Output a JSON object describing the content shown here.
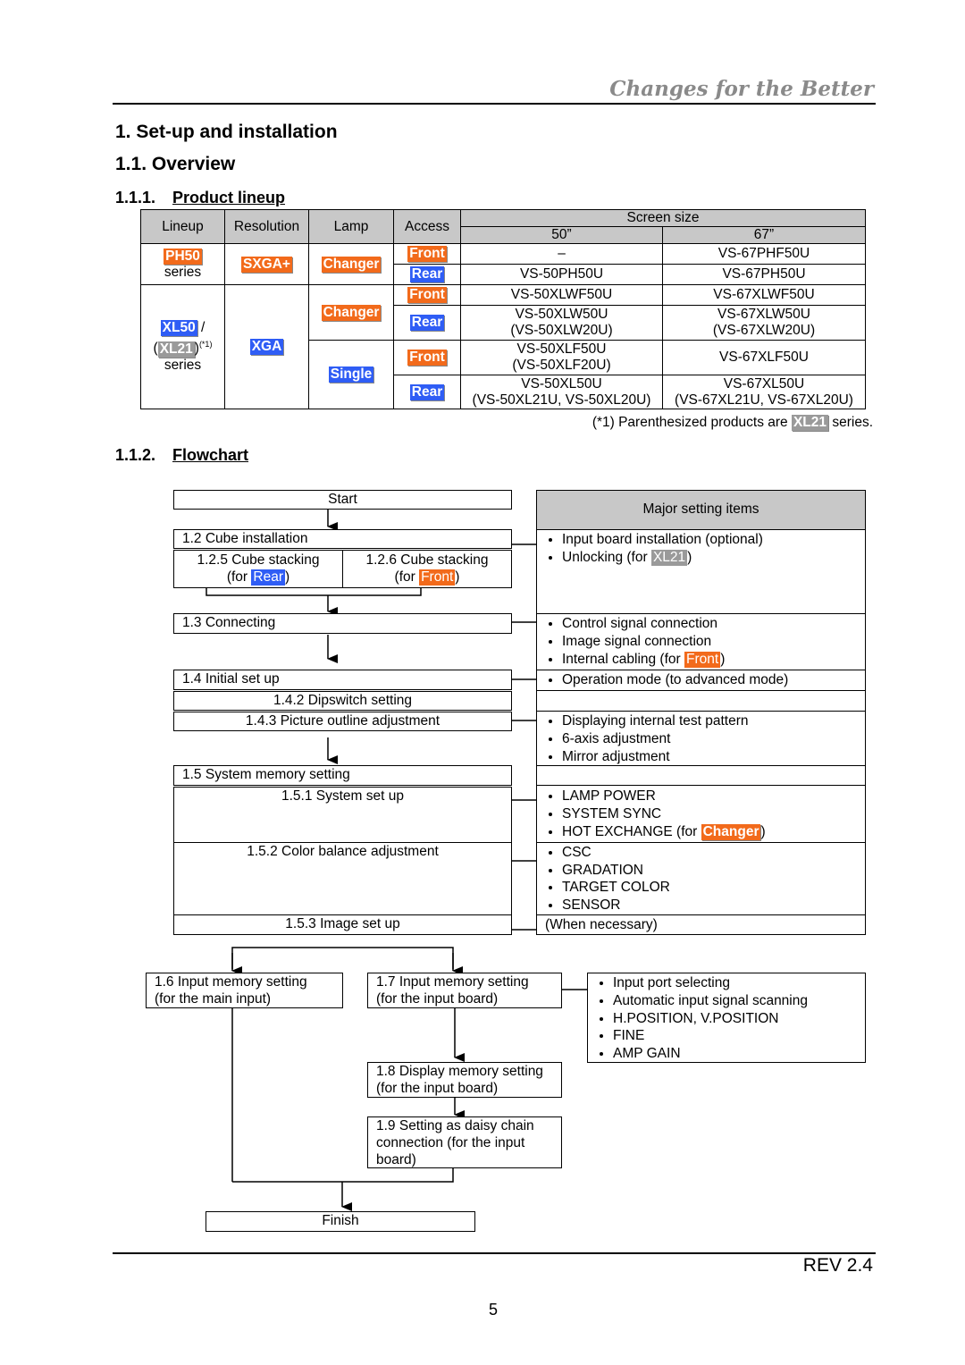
{
  "header": {
    "brand": "Changes for the Better"
  },
  "headings": {
    "h1": "1.   Set-up and installation",
    "h2": "1.1.   Overview",
    "h3a_num": "1.1.1.",
    "h3a": "Product lineup",
    "h3b_num": "1.1.2.",
    "h3b": "Flowchart"
  },
  "table": {
    "headers": {
      "lineup": "Lineup",
      "resolution": "Resolution",
      "lamp": "Lamp",
      "access": "Access",
      "screen": "Screen size",
      "s50": "50”",
      "s67": "67”"
    },
    "ph50": {
      "tag": "PH50",
      "series": "series",
      "res": "SXGA+",
      "lamp": "Changer",
      "rows": [
        {
          "access": "Front",
          "v50": "–",
          "v67": "VS-67PHF50U"
        },
        {
          "access": "Rear",
          "v50": "VS-50PH50U",
          "v67": "VS-67PH50U"
        }
      ]
    },
    "xl": {
      "tag1": "XL50",
      "sep": "/",
      "tag2": "XL21",
      "note": "(*1)",
      "series": "series",
      "res": "XGA",
      "lamp1": "Changer",
      "lamp2": "Single",
      "rows": [
        {
          "access": "Front",
          "v50a": "VS-50XLWF50U",
          "v50b": "",
          "v67a": "VS-67XLWF50U",
          "v67b": ""
        },
        {
          "access": "Rear",
          "v50a": "VS-50XLW50U",
          "v50b": "(VS-50XLW20U)",
          "v67a": "VS-67XLW50U",
          "v67b": "(VS-67XLW20U)"
        },
        {
          "access": "Front",
          "v50a": "VS-50XLF50U",
          "v50b": "(VS-50XLF20U)",
          "v67a": "VS-67XLF50U",
          "v67b": ""
        },
        {
          "access": "Rear",
          "v50a": "VS-50XL50U",
          "v50b": "(VS-50XL21U, VS-50XL20U)",
          "v67a": "VS-67XL50U",
          "v67b": "(VS-67XL21U, VS-67XL20U)"
        }
      ]
    },
    "footnote": {
      "pre": "(*1)  Parenthesized  products  are",
      "tag": "XL21",
      "post": "series."
    }
  },
  "flow": {
    "start": "Start",
    "s12": "1.2 Cube installation",
    "s125": "1.2.5 Cube stacking",
    "for": "(for",
    "close": ")",
    "rear": "Rear",
    "front": "Front",
    "s126": "1.2.6 Cube stacking",
    "s13": "1.3 Connecting",
    "s14": "1.4 Initial set up",
    "s142": "1.4.2 Dipswitch setting",
    "s143": "1.4.3 Picture outline adjustment",
    "s15": "1.5 System memory setting",
    "s151": "1.5.1 System set up",
    "s152": "1.5.2 Color balance adjustment",
    "s153": "1.5.3 Image set up",
    "s16a": "1.6 Input memory setting",
    "s16b": "(for the main input)",
    "s17a": "1.7 Input memory setting",
    "s17b": "(for the input board)",
    "s18a": "1.8 Display memory setting",
    "s18b": "(for the input board)",
    "s19a": "1.9 Setting as daisy chain",
    "s19b": "connection (for the input",
    "s19c": "board)",
    "finish": "Finish"
  },
  "major": {
    "title": "Major setting items",
    "g1": [
      "Input board installation (optional)",
      "Unlocking (for"
    ],
    "g1_tag": "XL21",
    "g2": [
      "Control signal connection",
      "Image signal connection",
      "Internal cabling (for"
    ],
    "g2_tag": "Front",
    "g3": [
      "Operation mode (to advanced mode)"
    ],
    "g4": [
      "Displaying internal test pattern",
      "6-axis adjustment",
      "Mirror adjustment"
    ],
    "g5": [
      "LAMP POWER",
      "SYSTEM SYNC",
      "HOT EXCHANGE (for"
    ],
    "g5_tag": "Changer",
    "g6": [
      "CSC",
      "GRADATION",
      "TARGET COLOR",
      "SENSOR"
    ],
    "g7": "(When necessary)",
    "g8": [
      "Input port selecting",
      "Automatic input signal scanning",
      "H.POSITION, V.POSITION",
      "FINE",
      "AMP GAIN"
    ]
  },
  "footer": {
    "rev": "REV 2.4",
    "page": "5"
  },
  "colors": {
    "orange": "#f26a1b",
    "blue": "#2f5df5",
    "gray": "#9a9a9a",
    "header_fill": "#c8c8c8"
  }
}
